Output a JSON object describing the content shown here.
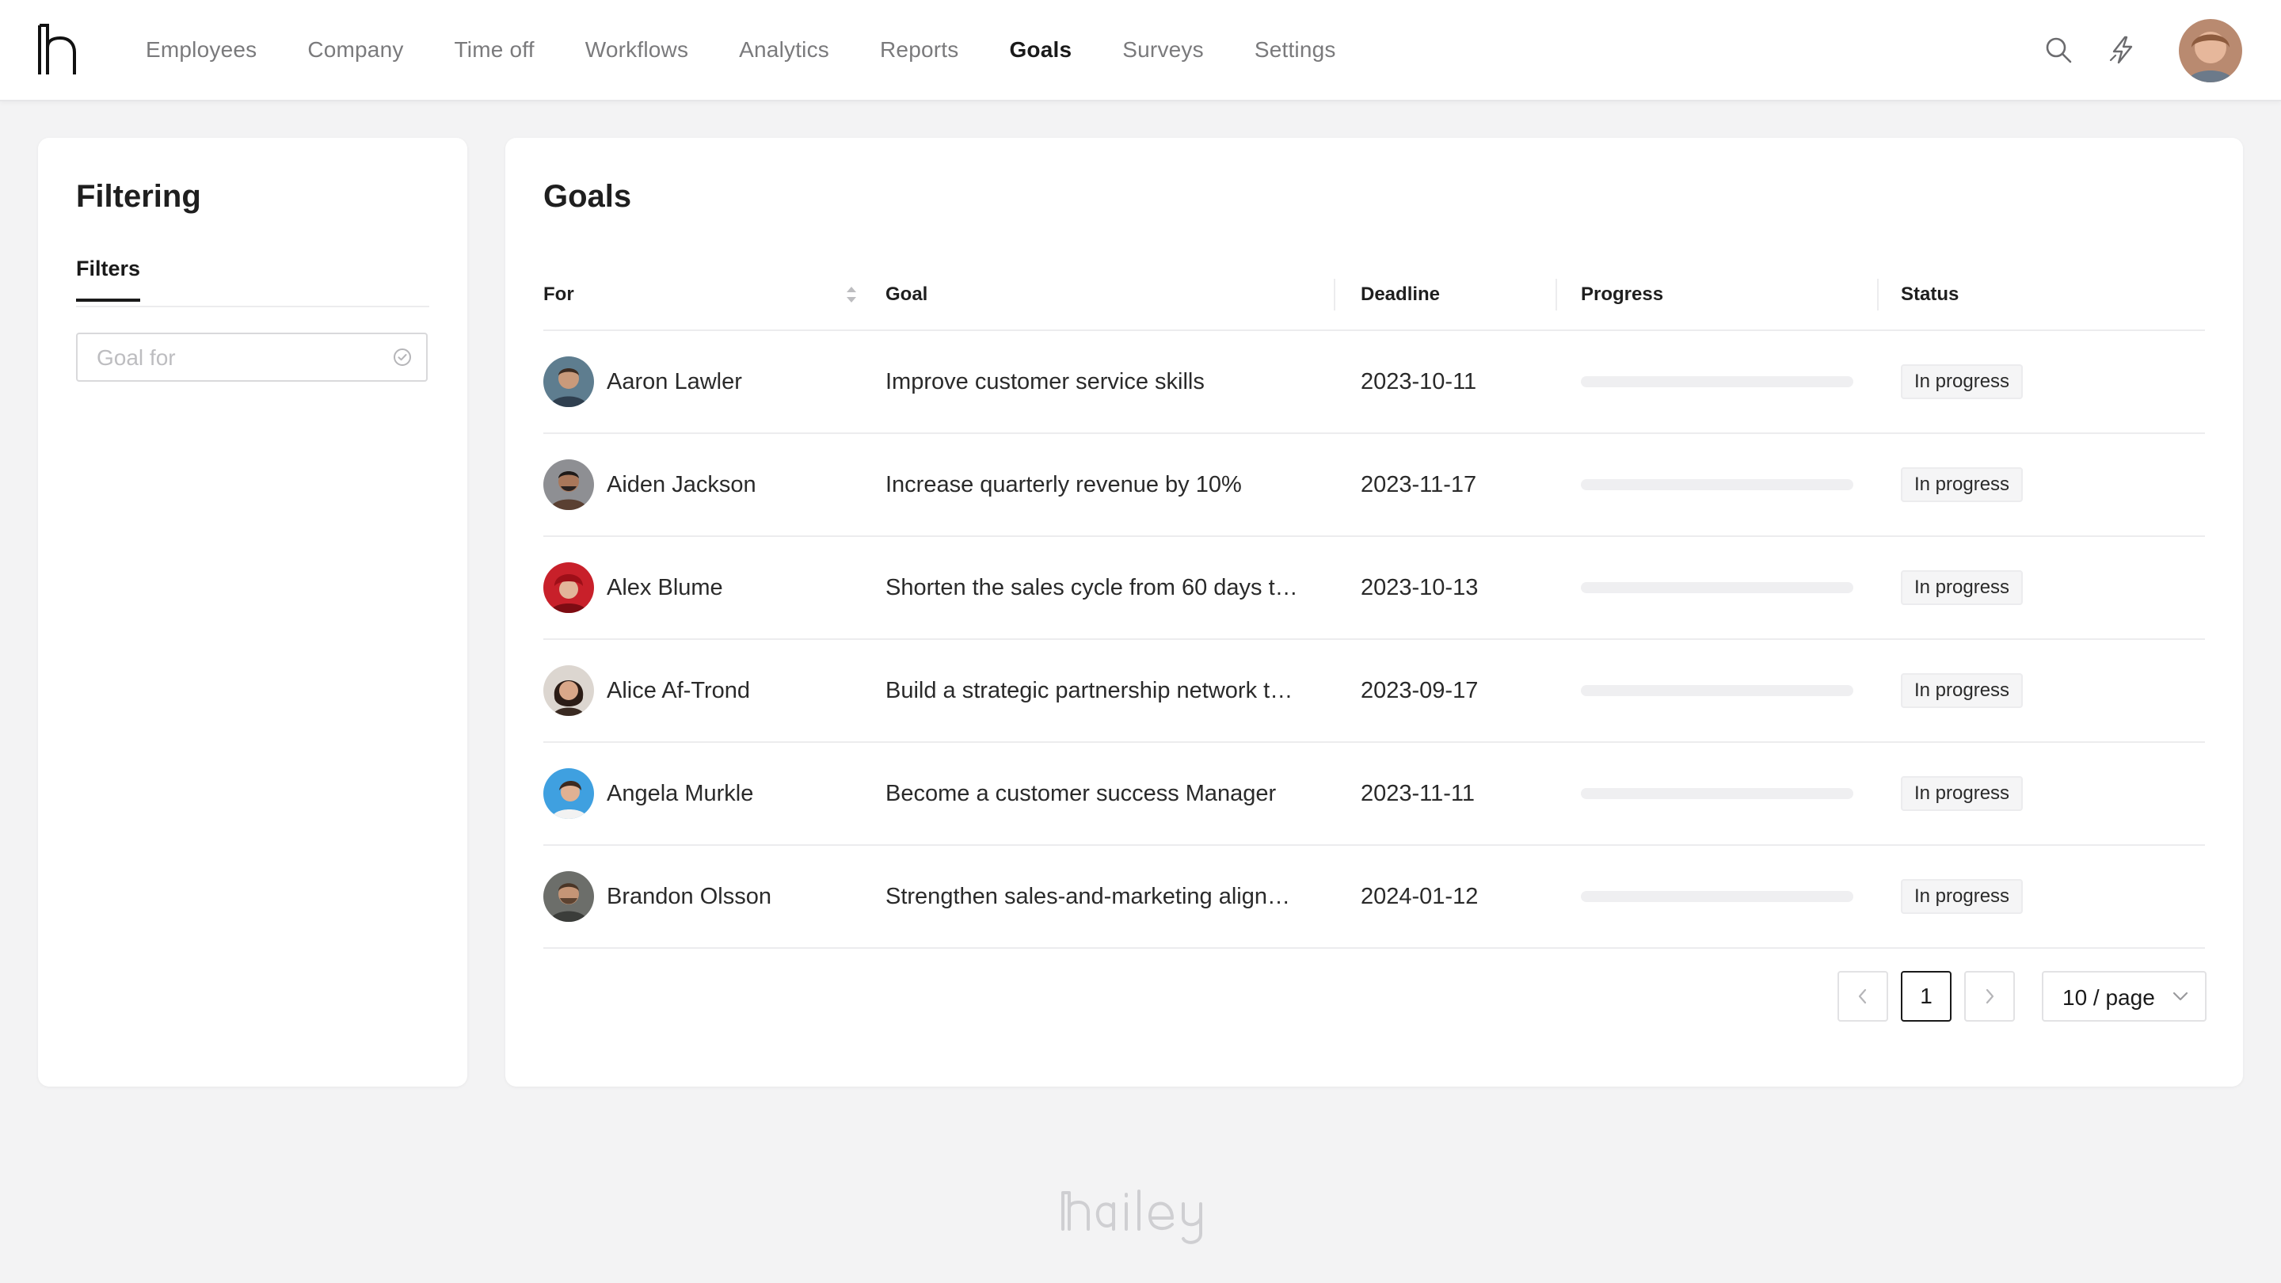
{
  "nav": {
    "items": [
      "Employees",
      "Company",
      "Time off",
      "Workflows",
      "Analytics",
      "Reports",
      "Goals",
      "Surveys",
      "Settings"
    ],
    "active": "Goals"
  },
  "icons": {
    "logo": "brand-h-logo",
    "search": "search-icon",
    "bolt": "lightning-icon",
    "avatar": "user-avatar"
  },
  "filtering": {
    "title": "Filtering",
    "tab_label": "Filters",
    "goal_for_placeholder": "Goal for",
    "goal_for_value": ""
  },
  "goals": {
    "title": "Goals",
    "columns": {
      "for": "For",
      "goal": "Goal",
      "deadline": "Deadline",
      "progress": "Progress",
      "status": "Status"
    },
    "rows": [
      {
        "name": "Aaron Lawler",
        "goal": "Improve customer service skills",
        "deadline": "2023-10-11",
        "progress": 0,
        "status": "In progress"
      },
      {
        "name": "Aiden Jackson",
        "goal": "Increase quarterly revenue by 10%",
        "deadline": "2023-11-17",
        "progress": 0,
        "status": "In progress"
      },
      {
        "name": "Alex Blume",
        "goal": "Shorten the sales cycle from 60 days to …",
        "deadline": "2023-10-13",
        "progress": 0,
        "status": "In progress"
      },
      {
        "name": "Alice Af-Trond",
        "goal": "Build a strategic partnership network to…",
        "deadline": "2023-09-17",
        "progress": 0,
        "status": "In progress"
      },
      {
        "name": "Angela Murkle",
        "goal": "Become a customer success Manager",
        "deadline": "2023-11-11",
        "progress": 0,
        "status": "In progress"
      },
      {
        "name": "Brandon Olsson",
        "goal": "Strengthen sales-and-marketing alignm…",
        "deadline": "2024-01-12",
        "progress": 0,
        "status": "In progress"
      }
    ]
  },
  "pagination": {
    "current_page": "1",
    "page_size": "10 / page"
  },
  "footer": {
    "wordmark": "hailey"
  },
  "colors": {
    "accent": "#1a1a1a",
    "background": "#f3f3f4",
    "muted_text": "#7a7a7c"
  }
}
